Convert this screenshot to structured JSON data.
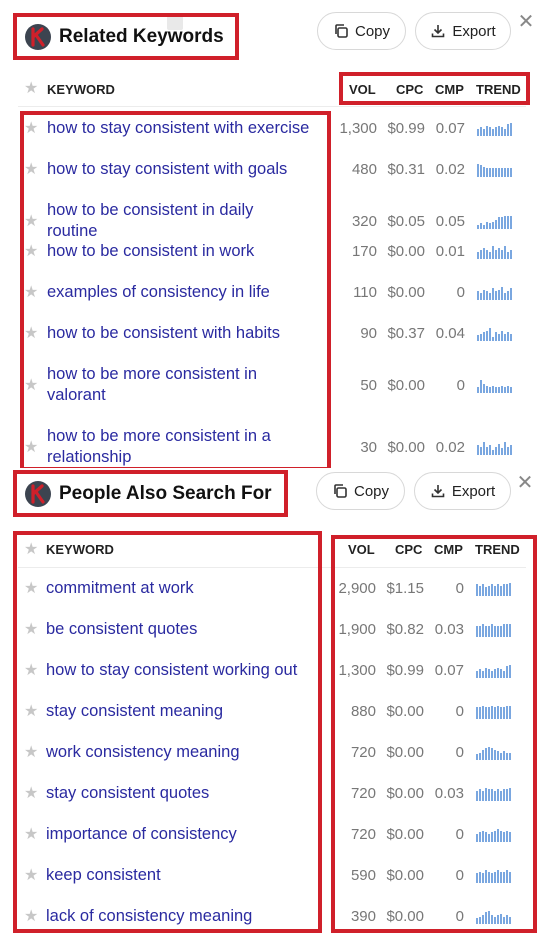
{
  "colors": {
    "highlight": "#d0202a",
    "link": "#2a2aa0",
    "trend_bar": "#7aa7e0"
  },
  "related": {
    "title": "Related Keywords",
    "copy_label": "Copy",
    "export_label": "Export",
    "close_label": "✕",
    "headers": {
      "keyword": "KEYWORD",
      "vol": "VOL",
      "cpc": "CPC",
      "cmp": "CMP",
      "trend": "TREND"
    },
    "rows": [
      {
        "keyword": "how to stay consistent with exercise",
        "vol": "1,300",
        "cpc": "$0.99",
        "cmp": "0.07",
        "trend": [
          5,
          6,
          5,
          7,
          6,
          5,
          6,
          7,
          6,
          5,
          8,
          9
        ]
      },
      {
        "keyword": "how to stay consistent with goals",
        "vol": "480",
        "cpc": "$0.31",
        "cmp": "0.02",
        "trend": [
          9,
          8,
          7,
          6,
          6,
          6,
          6,
          6,
          6,
          6,
          6,
          6
        ]
      },
      {
        "keyword": "how to be consistent in daily routine",
        "vol": "320",
        "cpc": "$0.05",
        "cmp": "0.05",
        "trend": [
          3,
          4,
          3,
          5,
          4,
          5,
          6,
          8,
          8,
          9,
          9,
          9
        ]
      },
      {
        "keyword": "how to be consistent in work",
        "vol": "170",
        "cpc": "$0.00",
        "cmp": "0.01",
        "trend": [
          4,
          5,
          6,
          5,
          4,
          7,
          5,
          6,
          5,
          7,
          4,
          5
        ]
      },
      {
        "keyword": "examples of consistency in life",
        "vol": "110",
        "cpc": "$0.00",
        "cmp": "0",
        "trend": [
          6,
          5,
          7,
          6,
          5,
          8,
          6,
          7,
          9,
          5,
          6,
          8
        ]
      },
      {
        "keyword": "how to be consistent with habits",
        "vol": "90",
        "cpc": "$0.37",
        "cmp": "0.04",
        "trend": [
          4,
          5,
          6,
          7,
          9,
          3,
          6,
          5,
          7,
          5,
          6,
          5
        ]
      },
      {
        "keyword": "how to be more consistent in valorant",
        "vol": "50",
        "cpc": "$0.00",
        "cmp": "0",
        "trend": [
          3,
          7,
          5,
          4,
          3,
          4,
          3,
          3,
          4,
          3,
          4,
          3
        ]
      },
      {
        "keyword": "how to be more consistent in a relationship",
        "vol": "30",
        "cpc": "$0.00",
        "cmp": "0.02",
        "trend": [
          6,
          5,
          8,
          5,
          6,
          3,
          5,
          7,
          4,
          8,
          5,
          6
        ]
      }
    ]
  },
  "people": {
    "title": "People Also Search For",
    "copy_label": "Copy",
    "export_label": "Export",
    "close_label": "✕",
    "headers": {
      "keyword": "KEYWORD",
      "vol": "VOL",
      "cpc": "CPC",
      "cmp": "CMP",
      "trend": "TREND"
    },
    "rows": [
      {
        "keyword": "commitment at work",
        "vol": "2,900",
        "cpc": "$1.15",
        "cmp": "0",
        "trend": [
          8,
          7,
          8,
          6,
          7,
          8,
          7,
          8,
          7,
          8,
          8,
          9
        ]
      },
      {
        "keyword": "be consistent quotes",
        "vol": "1,900",
        "cpc": "$0.82",
        "cmp": "0.03",
        "trend": [
          6,
          6,
          7,
          6,
          6,
          7,
          6,
          6,
          6,
          7,
          7,
          7
        ]
      },
      {
        "keyword": "how to stay consistent working out",
        "vol": "1,300",
        "cpc": "$0.99",
        "cmp": "0.07",
        "trend": [
          5,
          6,
          5,
          7,
          6,
          5,
          6,
          7,
          6,
          5,
          8,
          9
        ]
      },
      {
        "keyword": "stay consistent meaning",
        "vol": "880",
        "cpc": "$0.00",
        "cmp": "0",
        "trend": [
          8,
          8,
          9,
          8,
          8,
          9,
          8,
          9,
          8,
          8,
          9,
          9
        ]
      },
      {
        "keyword": "work consistency meaning",
        "vol": "720",
        "cpc": "$0.00",
        "cmp": "0",
        "trend": [
          4,
          5,
          7,
          8,
          9,
          8,
          7,
          6,
          5,
          6,
          5,
          5
        ]
      },
      {
        "keyword": "stay consistent quotes",
        "vol": "720",
        "cpc": "$0.00",
        "cmp": "0.03",
        "trend": [
          7,
          8,
          7,
          9,
          8,
          8,
          7,
          8,
          7,
          8,
          8,
          9
        ]
      },
      {
        "keyword": "importance of consistency",
        "vol": "720",
        "cpc": "$0.00",
        "cmp": "0",
        "trend": [
          5,
          6,
          7,
          6,
          5,
          6,
          7,
          8,
          7,
          6,
          7,
          6
        ]
      },
      {
        "keyword": "keep consistent",
        "vol": "590",
        "cpc": "$0.00",
        "cmp": "0",
        "trend": [
          6,
          7,
          6,
          8,
          7,
          6,
          7,
          8,
          7,
          7,
          8,
          7
        ]
      },
      {
        "keyword": "lack of consistency meaning",
        "vol": "390",
        "cpc": "$0.00",
        "cmp": "0",
        "trend": [
          4,
          5,
          6,
          8,
          9,
          6,
          5,
          6,
          7,
          5,
          6,
          5
        ]
      }
    ]
  }
}
